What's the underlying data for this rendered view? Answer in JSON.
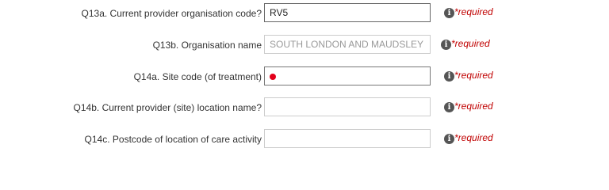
{
  "form": {
    "required_text": "*required",
    "info_glyph": "i",
    "rows": [
      {
        "label": "Q13a. Current provider organisation code?",
        "value": "RV5",
        "placeholder": ""
      },
      {
        "label": "Q13b. Organisation name",
        "value": "SOUTH LONDON AND MAUDSLEY NHS FOUNDATION TRUST",
        "placeholder": ""
      },
      {
        "label": "Q14a. Site code (of treatment)",
        "value": "",
        "placeholder": ""
      },
      {
        "label": "Q14b. Current provider (site) location name?",
        "value": "",
        "placeholder": ""
      },
      {
        "label": "Q14c. Postcode of location of care activity",
        "value": "",
        "placeholder": ""
      }
    ]
  },
  "colors": {
    "required": "#c00000",
    "validation_dot": "#e3001b",
    "info_icon": "#555555",
    "readonly_text": "#999999"
  },
  "icons": {
    "info": "info-icon",
    "validation": "red-dot-indicator"
  }
}
